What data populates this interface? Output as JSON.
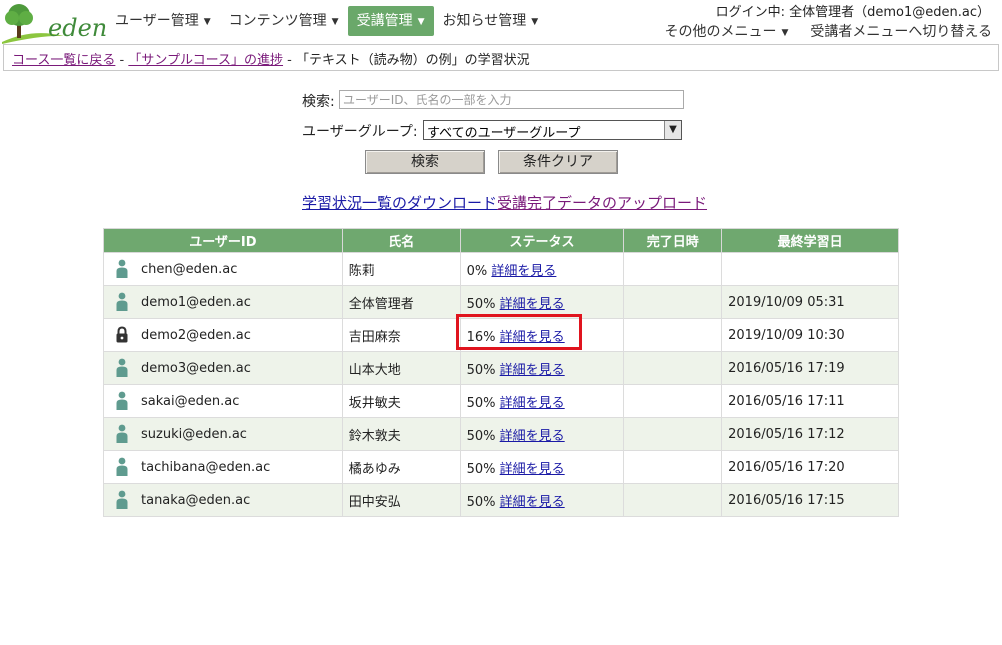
{
  "colors": {
    "accent": "#6fa86f",
    "highlight": "#e0141e",
    "link": "#1a1aa6",
    "visited": "#7a1a7a"
  },
  "header": {
    "logo_text": "eden",
    "nav": [
      {
        "label": "ユーザー管理",
        "active": false
      },
      {
        "label": "コンテンツ管理",
        "active": false
      },
      {
        "label": "受講管理",
        "active": true
      },
      {
        "label": "お知らせ管理",
        "active": false
      }
    ],
    "login_info": "ログイン中: 全体管理者（demo1@eden.ac）",
    "other_menu": "その他のメニュー",
    "switch_menu": "受講者メニューへ切り替える"
  },
  "breadcrumb": {
    "link1": "コース一覧に戻る",
    "sep1": " - ",
    "link2": "「サンプルコース」の進捗",
    "sep2": " - ",
    "current": "「テキスト（読み物）の例」の学習状況"
  },
  "search": {
    "label": "検索:",
    "placeholder": "ユーザーID、氏名の一部を入力",
    "group_label": "ユーザーグループ:",
    "group_selected": "すべてのユーザーグループ",
    "search_button": "検索",
    "clear_button": "条件クリア"
  },
  "links": {
    "download": "学習状況一覧のダウンロード",
    "upload": "受講完了データのアップロード"
  },
  "table": {
    "headers": [
      "ユーザーID",
      "氏名",
      "ステータス",
      "完了日時",
      "最終学習日"
    ],
    "detail_label": "詳細を見る",
    "rows": [
      {
        "user_id": "chen@eden.ac",
        "name": "陈莉",
        "progress": "0%",
        "completed": "",
        "last_study": "",
        "icon": "person-icon"
      },
      {
        "user_id": "demo1@eden.ac",
        "name": "全体管理者",
        "progress": "50%",
        "completed": "",
        "last_study": "2019/10/09 05:31",
        "icon": "person-icon"
      },
      {
        "user_id": "demo2@eden.ac",
        "name": "吉田麻奈",
        "progress": "16%",
        "completed": "",
        "last_study": "2019/10/09 10:30",
        "icon": "lock-icon",
        "highlighted": true
      },
      {
        "user_id": "demo3@eden.ac",
        "name": "山本大地",
        "progress": "50%",
        "completed": "",
        "last_study": "2016/05/16 17:19",
        "icon": "person-icon"
      },
      {
        "user_id": "sakai@eden.ac",
        "name": "坂井敏夫",
        "progress": "50%",
        "completed": "",
        "last_study": "2016/05/16 17:11",
        "icon": "person-icon"
      },
      {
        "user_id": "suzuki@eden.ac",
        "name": "鈴木敦夫",
        "progress": "50%",
        "completed": "",
        "last_study": "2016/05/16 17:12",
        "icon": "person-icon"
      },
      {
        "user_id": "tachibana@eden.ac",
        "name": "橘あゆみ",
        "progress": "50%",
        "completed": "",
        "last_study": "2016/05/16 17:20",
        "icon": "person-icon"
      },
      {
        "user_id": "tanaka@eden.ac",
        "name": "田中安弘",
        "progress": "50%",
        "completed": "",
        "last_study": "2016/05/16 17:15",
        "icon": "person-icon"
      }
    ]
  }
}
